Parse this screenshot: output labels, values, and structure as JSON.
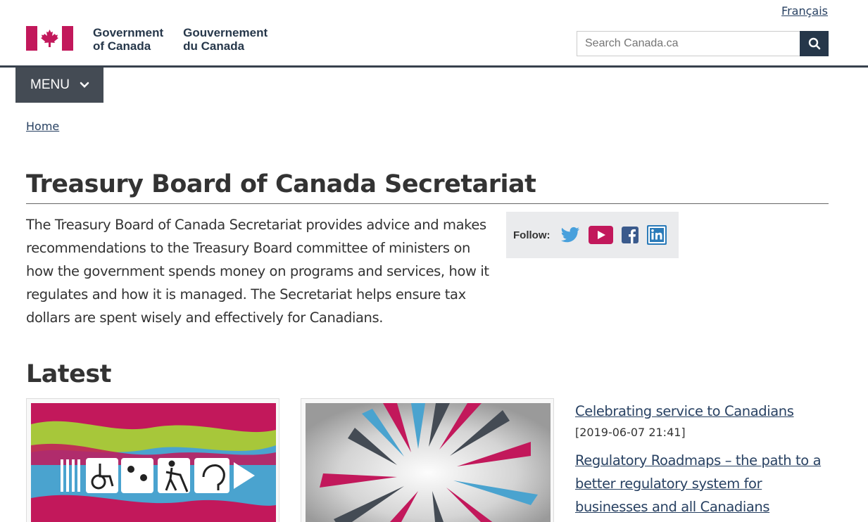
{
  "header": {
    "language_link": "Français",
    "signature_en_line1": "Government",
    "signature_en_line2": "of Canada",
    "signature_fr_line1": "Gouvernement",
    "signature_fr_line2": "du Canada",
    "search_placeholder": "Search Canada.ca",
    "menu_label": "MENU",
    "colors": {
      "flag_red": "#c2185b",
      "nav_dark": "#444b54",
      "search_button": "#26374a"
    }
  },
  "breadcrumb": {
    "items": [
      "Home"
    ]
  },
  "main": {
    "title": "Treasury Board of Canada Secretariat",
    "intro": "The Treasury Board of Canada Secretariat provides advice and makes recommendations to the Treasury Board committee of ministers on how the government spends money on programs and services, how it regulates and how it is managed. The Secretariat helps ensure tax dollars are spent wisely and effectively for Canadians.",
    "follow": {
      "label": "Follow:",
      "icons": [
        "twitter-icon",
        "youtube-icon",
        "facebook-icon",
        "linkedin-icon"
      ]
    },
    "latest": {
      "heading": "Latest",
      "news": [
        {
          "title": "Celebrating service to Canadians",
          "date": "[2019-06-07 21:41]"
        },
        {
          "title": "Regulatory Roadmaps – the path to a better regulatory system for businesses and all Canadians"
        }
      ]
    }
  }
}
